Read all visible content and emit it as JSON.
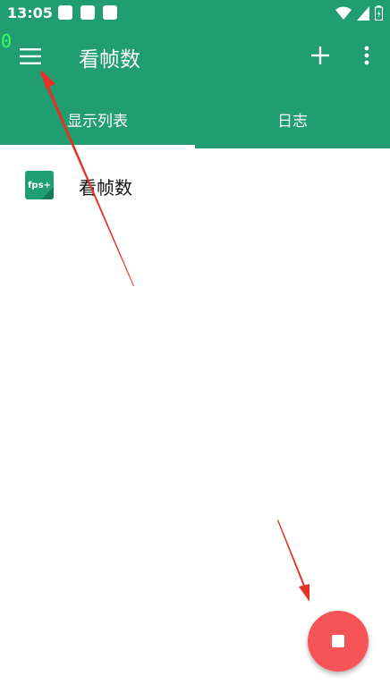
{
  "status_bar": {
    "time": "13:05"
  },
  "overlay": {
    "counter": "0"
  },
  "app_bar": {
    "title": "看帧数"
  },
  "tabs": [
    {
      "label": "显示列表",
      "active": true
    },
    {
      "label": "日志",
      "active": false
    }
  ],
  "list": {
    "items": [
      {
        "icon_text": "fps+",
        "label": "看帧数"
      }
    ]
  },
  "colors": {
    "primary": "#219d72",
    "fab": "#f65456",
    "annotation_arrow": "#e53227",
    "overlay_counter": "#39ff5a"
  },
  "icons": {
    "menu": "hamburger-menu-icon",
    "add": "plus-icon",
    "more": "more-vertical-icon",
    "fab": "stop-icon"
  }
}
